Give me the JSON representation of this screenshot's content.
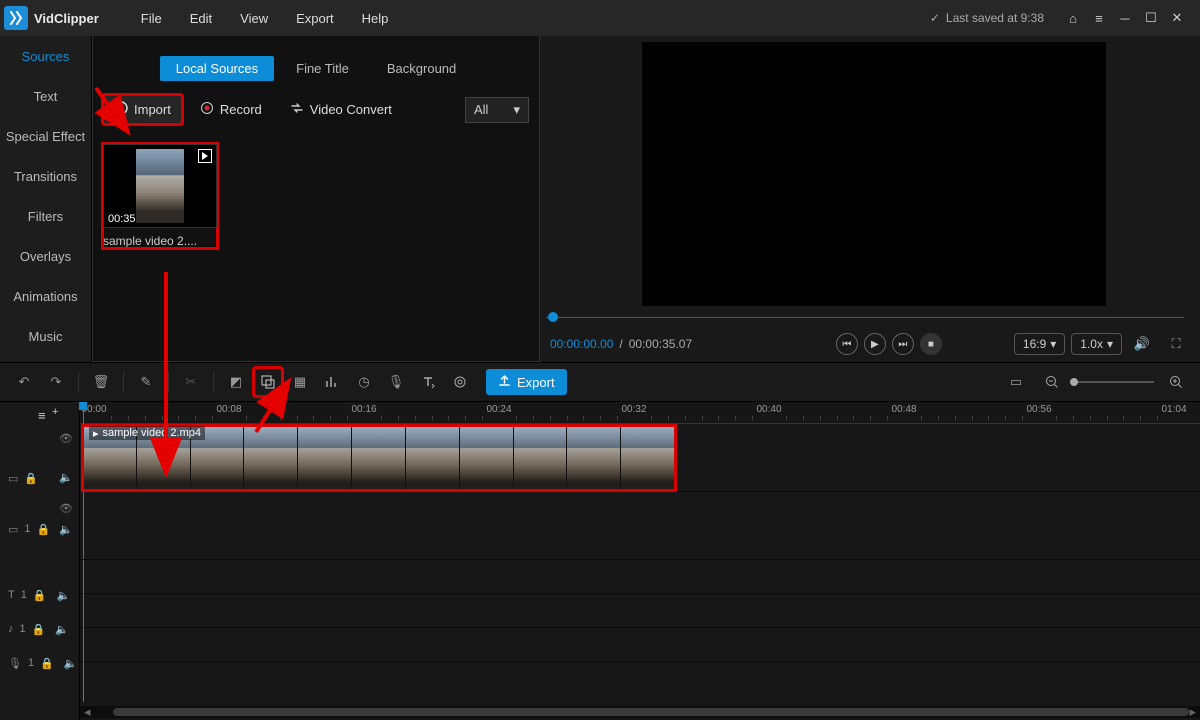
{
  "titlebar": {
    "app_name": "VidClipper",
    "menu": [
      "File",
      "Edit",
      "View",
      "Export",
      "Help"
    ],
    "saved": "Last saved at 9:38"
  },
  "left_tabs": [
    "Sources",
    "Text",
    "Special Effect",
    "Transitions",
    "Filters",
    "Overlays",
    "Animations",
    "Music"
  ],
  "media": {
    "subtabs": [
      "Local Sources",
      "Fine Title",
      "Background"
    ],
    "import_label": "Import",
    "record_label": "Record",
    "convert_label": "Video Convert",
    "filter": "All",
    "thumb": {
      "duration": "00:35",
      "name": "sample video 2...."
    }
  },
  "preview": {
    "time_current": "00:00:00.00",
    "time_sep": " / ",
    "time_total": "00:00:35.07",
    "ratio": "16:9",
    "speed": "1.0x"
  },
  "timeline": {
    "export_label": "Export",
    "ticks": [
      "00:00",
      "00:08",
      "00:16",
      "00:24",
      "00:32",
      "00:40",
      "00:48",
      "00:56",
      "01:04"
    ],
    "clip_label": "sample video 2.mp4",
    "track1_count": "1",
    "trackT_count": "1",
    "trackA_count": "1",
    "trackM_count": "1"
  }
}
